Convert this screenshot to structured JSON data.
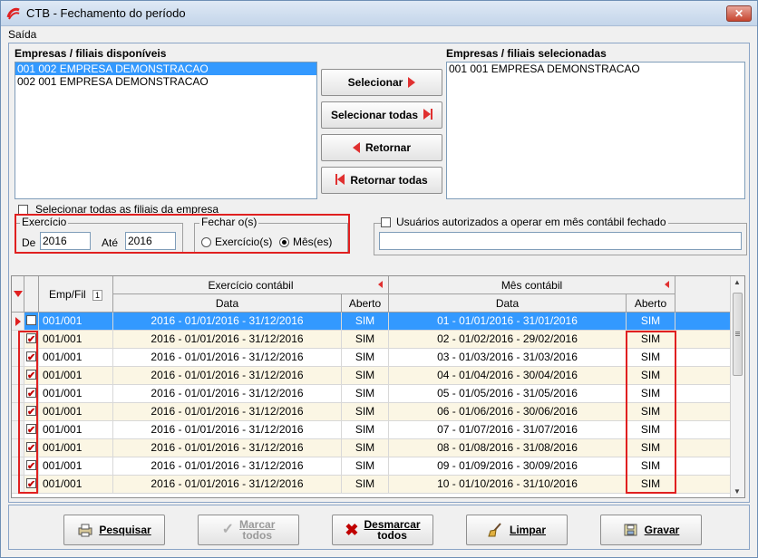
{
  "window": {
    "title": "CTB - Fechamento do período",
    "close_label": "✕"
  },
  "menu": {
    "saida": "Saída"
  },
  "left_list": {
    "label": "Empresas / filiais disponíveis",
    "items": [
      "001 002 EMPRESA DEMONSTRACAO",
      "002 001 EMPRESA DEMONSTRACAO"
    ],
    "selected_index": 0
  },
  "right_list": {
    "label": "Empresas / filiais selecionadas",
    "items": [
      "001 001 EMPRESA DEMONSTRACAO"
    ]
  },
  "buttons": {
    "selecionar": "Selecionar",
    "selecionar_todas": "Selecionar todas",
    "retornar": "Retornar",
    "retornar_todas": "Retornar todas"
  },
  "select_all_branches": {
    "label": "Selecionar todas as filiais da empresa",
    "checked": false
  },
  "exercicio": {
    "legend": "Exercício",
    "de_label": "De",
    "de_value": "2016",
    "ate_label": "Até",
    "ate_value": "2016"
  },
  "fechar": {
    "legend": "Fechar o(s)",
    "option_exercicio": "Exercício(s)",
    "option_mes": "Mês(es)",
    "selected": "mes"
  },
  "usuarios": {
    "label": "Usuários autorizados a operar em mês contábil fechado",
    "value": "",
    "checked": false
  },
  "grid": {
    "col_empfil": "Emp/Fil",
    "sort_badge": "1",
    "group_exercicio": "Exercício contábil",
    "group_mes": "Mês contábil",
    "col_data": "Data",
    "col_aberto": "Aberto",
    "rows": [
      {
        "checked": false,
        "empfil": "001/001",
        "ex_data": "2016 - 01/01/2016 - 31/12/2016",
        "ex_aberto": "SIM",
        "mes_data": "01 - 01/01/2016 - 31/01/2016",
        "mes_aberto": "SIM"
      },
      {
        "checked": true,
        "empfil": "001/001",
        "ex_data": "2016 - 01/01/2016 - 31/12/2016",
        "ex_aberto": "SIM",
        "mes_data": "02 - 01/02/2016 - 29/02/2016",
        "mes_aberto": "SIM"
      },
      {
        "checked": true,
        "empfil": "001/001",
        "ex_data": "2016 - 01/01/2016 - 31/12/2016",
        "ex_aberto": "SIM",
        "mes_data": "03 - 01/03/2016 - 31/03/2016",
        "mes_aberto": "SIM"
      },
      {
        "checked": true,
        "empfil": "001/001",
        "ex_data": "2016 - 01/01/2016 - 31/12/2016",
        "ex_aberto": "SIM",
        "mes_data": "04 - 01/04/2016 - 30/04/2016",
        "mes_aberto": "SIM"
      },
      {
        "checked": true,
        "empfil": "001/001",
        "ex_data": "2016 - 01/01/2016 - 31/12/2016",
        "ex_aberto": "SIM",
        "mes_data": "05 - 01/05/2016 - 31/05/2016",
        "mes_aberto": "SIM"
      },
      {
        "checked": true,
        "empfil": "001/001",
        "ex_data": "2016 - 01/01/2016 - 31/12/2016",
        "ex_aberto": "SIM",
        "mes_data": "06 - 01/06/2016 - 30/06/2016",
        "mes_aberto": "SIM"
      },
      {
        "checked": true,
        "empfil": "001/001",
        "ex_data": "2016 - 01/01/2016 - 31/12/2016",
        "ex_aberto": "SIM",
        "mes_data": "07 - 01/07/2016 - 31/07/2016",
        "mes_aberto": "SIM"
      },
      {
        "checked": true,
        "empfil": "001/001",
        "ex_data": "2016 - 01/01/2016 - 31/12/2016",
        "ex_aberto": "SIM",
        "mes_data": "08 - 01/08/2016 - 31/08/2016",
        "mes_aberto": "SIM"
      },
      {
        "checked": true,
        "empfil": "001/001",
        "ex_data": "2016 - 01/01/2016 - 31/12/2016",
        "ex_aberto": "SIM",
        "mes_data": "09 - 01/09/2016 - 30/09/2016",
        "mes_aberto": "SIM"
      },
      {
        "checked": true,
        "empfil": "001/001",
        "ex_data": "2016 - 01/01/2016 - 31/12/2016",
        "ex_aberto": "SIM",
        "mes_data": "10 - 01/10/2016 - 31/10/2016",
        "mes_aberto": "SIM"
      }
    ]
  },
  "bottom": {
    "pesquisar": "Pesquisar",
    "marcar_todos_1": "Marcar",
    "marcar_todos_2": "todos",
    "desmarcar_todos_1": "Desmarcar",
    "desmarcar_todos_2": "todos",
    "limpar": "Limpar",
    "gravar": "Gravar"
  },
  "colors": {
    "selection": "#3399ff",
    "accent_red": "#e02020",
    "row_alt": "#fbf6e4"
  }
}
